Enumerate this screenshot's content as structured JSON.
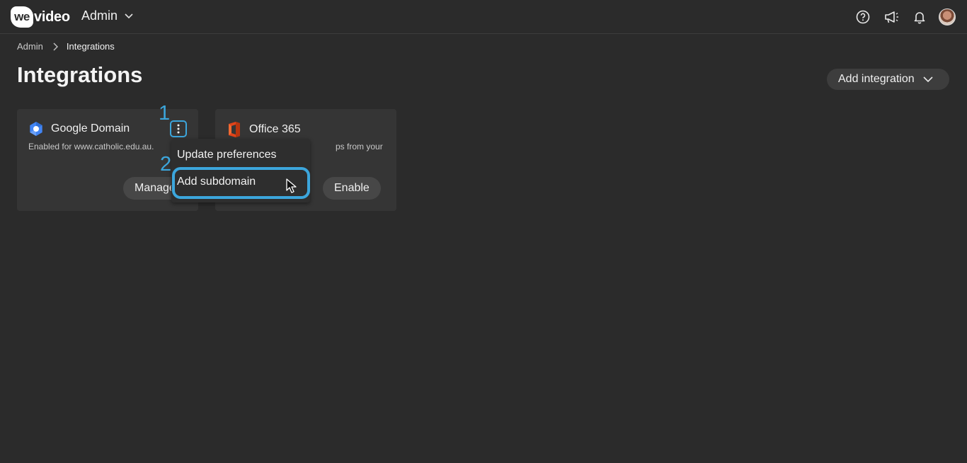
{
  "topbar": {
    "logo_we": "we",
    "logo_video": "video",
    "app_name": "Admin",
    "icons": [
      "help-icon",
      "announcement-icon",
      "bell-icon",
      "avatar"
    ]
  },
  "breadcrumb": {
    "parent": "Admin",
    "current": "Integrations"
  },
  "page": {
    "title": "Integrations",
    "add_integration_label": "Add integration"
  },
  "cards": [
    {
      "title": "Google Domain",
      "description": "Enabled for www.catholic.edu.au.",
      "button": "Manage",
      "icon": "google-workspace-icon"
    },
    {
      "title": "Office 365",
      "description": "ps from your",
      "button": "Enable",
      "icon": "office-365-icon"
    }
  ],
  "menu": {
    "items": [
      "Update preferences",
      "Add subdomain"
    ]
  },
  "annotations": {
    "step1": "1",
    "step2": "2"
  },
  "colors": {
    "background": "#2b2b2b",
    "card": "#353535",
    "accent": "#3ca6dc"
  }
}
